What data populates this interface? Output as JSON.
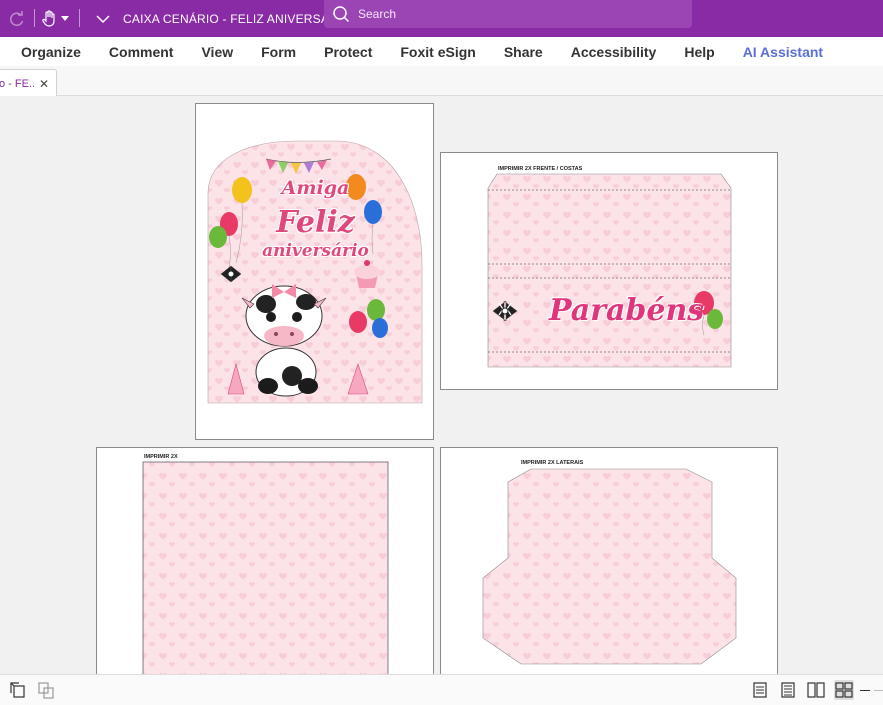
{
  "titlebar": {
    "title": "CAIXA CENÁRIO - FELIZ ANIVERSÁRIO...",
    "search_placeholder": "Search",
    "icons": [
      "redo-icon",
      "hand-tool-icon",
      "dropdown-arrow-icon",
      "customize-icon",
      "search-icon"
    ]
  },
  "menu": {
    "items": [
      "Organize",
      "Comment",
      "View",
      "Form",
      "Protect",
      "Foxit eSign",
      "Share",
      "Accessibility",
      "Help",
      "AI Assistant"
    ]
  },
  "tab": {
    "label": "o - FE..."
  },
  "pages": {
    "page1": {
      "line1": "Amiga",
      "line2": "Feliz",
      "line3": "aniversário"
    },
    "page2": {
      "print_label": "IMPRIMIR 2X FRENTE / COSTAS",
      "banner_text": "Parabéns"
    },
    "page3": {
      "print_label": "IMPRIMIR 2X"
    },
    "page4": {
      "print_label": "IMPRIMIR 2X LATERAIS"
    }
  },
  "colors": {
    "titlebar": "#8a2ba6",
    "accent_ai": "#5b6fd8",
    "card_pink": "#fbe3e8",
    "title_pink": "#e0487c"
  },
  "statusbar": {
    "icons": [
      "rotate-view-icon",
      "page-copy-icon",
      "single-page-icon",
      "continuous-page-icon",
      "two-page-icon",
      "two-page-continuous-icon"
    ]
  }
}
